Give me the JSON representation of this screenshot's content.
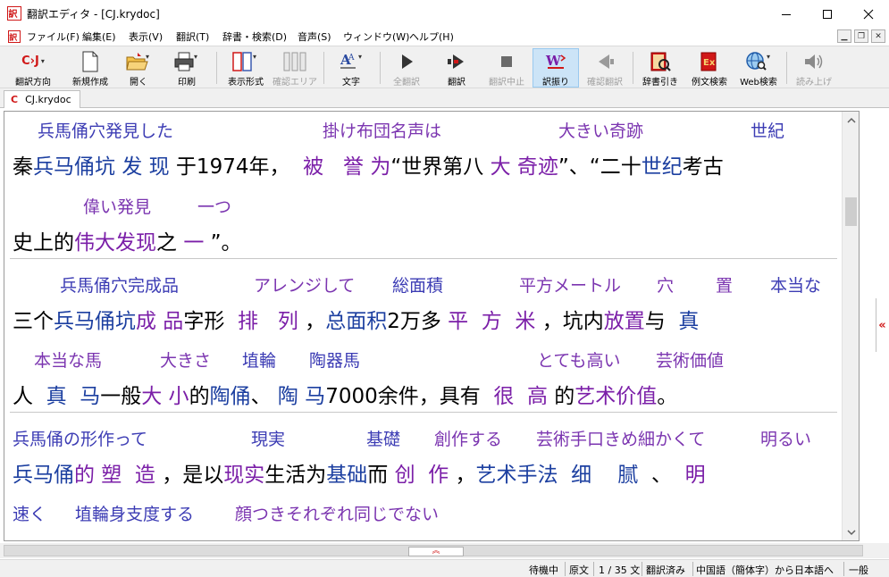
{
  "window": {
    "title": "翻訳エディタ - [CJ.krydoc]",
    "app_icon": "app-logo-icon"
  },
  "menu": [
    {
      "label": "ファイル(F)"
    },
    {
      "label": "編集(E)"
    },
    {
      "label": "表示(V)"
    },
    {
      "label": "翻訳(T)"
    },
    {
      "label": "辞書・検索(D)"
    },
    {
      "label": "音声(S)"
    },
    {
      "label": "ウィンドウ(W)"
    },
    {
      "label": "ヘルプ(H)"
    }
  ],
  "toolbar": {
    "direction_icon_text": "C›J",
    "items": [
      {
        "label": "翻訳方向",
        "enabled": true
      },
      {
        "label": "新規作成",
        "enabled": true
      },
      {
        "label": "開く",
        "enabled": true
      },
      {
        "label": "印刷",
        "enabled": true
      },
      {
        "label": "表示形式",
        "enabled": true
      },
      {
        "label": "確認エリア",
        "enabled": false
      },
      {
        "label": "文字",
        "enabled": true
      },
      {
        "label": "全翻訳",
        "enabled": false
      },
      {
        "label": "翻訳",
        "enabled": true
      },
      {
        "label": "翻訳中止",
        "enabled": false
      },
      {
        "label": "訳振り",
        "enabled": true,
        "selected": true
      },
      {
        "label": "確認翻訳",
        "enabled": false
      },
      {
        "label": "辞書引き",
        "enabled": true
      },
      {
        "label": "例文検索",
        "enabled": true
      },
      {
        "label": "Web検索",
        "enabled": true
      },
      {
        "label": "読み上げ",
        "enabled": false
      }
    ]
  },
  "tab": {
    "icon_text": "C",
    "label": "CJ.krydoc"
  },
  "document": {
    "ruby": [
      "兵馬俑穴発見した",
      "掛け布団名声は",
      "大きい奇跡",
      "世紀",
      "偉い発見",
      "一つ",
      "兵馬俑穴完成品",
      "アレンジして",
      "総面積",
      "平方メートル",
      "穴",
      "置",
      "本当な",
      "本当な馬",
      "大きさ",
      "埴輪",
      "陶器馬",
      "とても高い",
      "芸術価値",
      "兵馬俑の形作って",
      "現実",
      "基礎",
      "創作する",
      "芸術手口きめ細かくて",
      "明るい",
      "速く",
      "埴輪身支度する",
      "顔つきそれぞれ同じでない"
    ],
    "lines": [
      [
        {
          "t": "秦",
          "c": "k"
        },
        {
          "t": "兵马俑坑",
          "c": "b"
        },
        {
          "t": " ",
          "c": "k"
        },
        {
          "t": "发",
          "c": "b"
        },
        {
          "t": " ",
          "c": "k"
        },
        {
          "t": "现",
          "c": "b"
        },
        {
          "t": " 于1974年，  ",
          "c": "k"
        },
        {
          "t": "被",
          "c": "p"
        },
        {
          "t": "   ",
          "c": "k"
        },
        {
          "t": "誉",
          "c": "p"
        },
        {
          "t": " ",
          "c": "k"
        },
        {
          "t": "为",
          "c": "p"
        },
        {
          "t": "“世界第八 ",
          "c": "k"
        },
        {
          "t": "大",
          "c": "p"
        },
        {
          "t": " ",
          "c": "k"
        },
        {
          "t": "奇迹",
          "c": "p"
        },
        {
          "t": "”、“二十",
          "c": "k"
        },
        {
          "t": "世纪",
          "c": "b"
        },
        {
          "t": "考古",
          "c": "k"
        }
      ],
      [
        {
          "t": "史上的",
          "c": "k"
        },
        {
          "t": "伟大发现",
          "c": "p"
        },
        {
          "t": "之 ",
          "c": "k"
        },
        {
          "t": "一",
          "c": "p"
        },
        {
          "t": " ”。",
          "c": "k"
        }
      ],
      [
        {
          "t": "三个",
          "c": "k"
        },
        {
          "t": "兵马俑坑",
          "c": "b"
        },
        {
          "t": "成 品",
          "c": "p"
        },
        {
          "t": "字形  ",
          "c": "k"
        },
        {
          "t": "排",
          "c": "p"
        },
        {
          "t": "   ",
          "c": "k"
        },
        {
          "t": "列",
          "c": "p"
        },
        {
          "t": " ，",
          "c": "k"
        },
        {
          "t": "总面积",
          "c": "b"
        },
        {
          "t": "2万多 ",
          "c": "k"
        },
        {
          "t": "平",
          "c": "p"
        },
        {
          "t": "  ",
          "c": "k"
        },
        {
          "t": "方",
          "c": "p"
        },
        {
          "t": "  ",
          "c": "k"
        },
        {
          "t": "米",
          "c": "p"
        },
        {
          "t": " ，坑内",
          "c": "k"
        },
        {
          "t": "放置",
          "c": "p"
        },
        {
          "t": "与  ",
          "c": "k"
        },
        {
          "t": "真",
          "c": "b"
        }
      ],
      [
        {
          "t": "人  ",
          "c": "k"
        },
        {
          "t": "真",
          "c": "b"
        },
        {
          "t": "  ",
          "c": "k"
        },
        {
          "t": "马",
          "c": "b"
        },
        {
          "t": "一般",
          "c": "k"
        },
        {
          "t": "大 小",
          "c": "p"
        },
        {
          "t": "的",
          "c": "k"
        },
        {
          "t": "陶俑",
          "c": "b"
        },
        {
          "t": "、 ",
          "c": "k"
        },
        {
          "t": "陶 马",
          "c": "b"
        },
        {
          "t": "7000余件，具有  ",
          "c": "k"
        },
        {
          "t": "很",
          "c": "p"
        },
        {
          "t": "  ",
          "c": "k"
        },
        {
          "t": "高",
          "c": "p"
        },
        {
          "t": " 的",
          "c": "k"
        },
        {
          "t": "艺术价值",
          "c": "p"
        },
        {
          "t": "。",
          "c": "k"
        }
      ],
      [
        {
          "t": "兵马俑",
          "c": "b"
        },
        {
          "t": "的 塑  造",
          "c": "p"
        },
        {
          "t": " ，是以",
          "c": "k"
        },
        {
          "t": "现实",
          "c": "p"
        },
        {
          "t": "生活为",
          "c": "k"
        },
        {
          "t": "基础",
          "c": "b"
        },
        {
          "t": "而 ",
          "c": "k"
        },
        {
          "t": "创  作",
          "c": "p"
        },
        {
          "t": " ，",
          "c": "k"
        },
        {
          "t": "艺术手法",
          "c": "b"
        },
        {
          "t": "  ",
          "c": "k"
        },
        {
          "t": "细",
          "c": "b"
        },
        {
          "t": "    ",
          "c": "k"
        },
        {
          "t": "腻",
          "c": "b"
        },
        {
          "t": "  、  ",
          "c": "k"
        },
        {
          "t": "明",
          "c": "p"
        }
      ]
    ]
  },
  "status": {
    "state": "待機中",
    "view": "原文",
    "page": "1 / 35 文",
    "translated": "翻訳済み",
    "direction": "中国語（簡体字）から日本語へ",
    "field": "一般"
  },
  "colors": {
    "ruby_blue": "#3c3cb4",
    "ruby_purple": "#7b35b0",
    "source_blue": "#1c3fa0",
    "source_purple": "#7b1fa8",
    "accent_red": "#d01818",
    "selected_bg": "#cce4f7"
  }
}
